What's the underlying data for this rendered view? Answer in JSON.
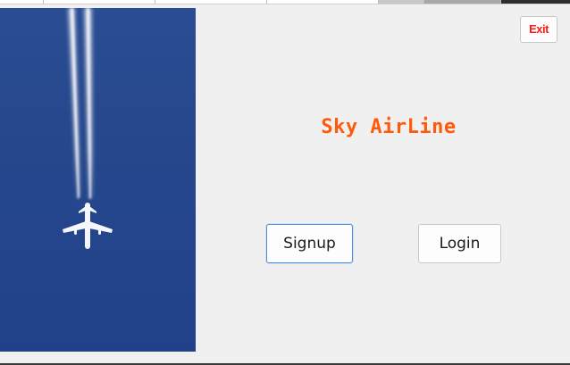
{
  "app": {
    "title": "Sky AirLine",
    "title_color": "#ff5a0a"
  },
  "buttons": {
    "exit_label": "Exit",
    "signup_label": "Signup",
    "login_label": "Login",
    "exit_color": "#ff1a1a",
    "focus_border_color": "#4a8fdc"
  },
  "image": {
    "icon": "airplane-contrail-photo",
    "sky_color": "#26478c"
  }
}
